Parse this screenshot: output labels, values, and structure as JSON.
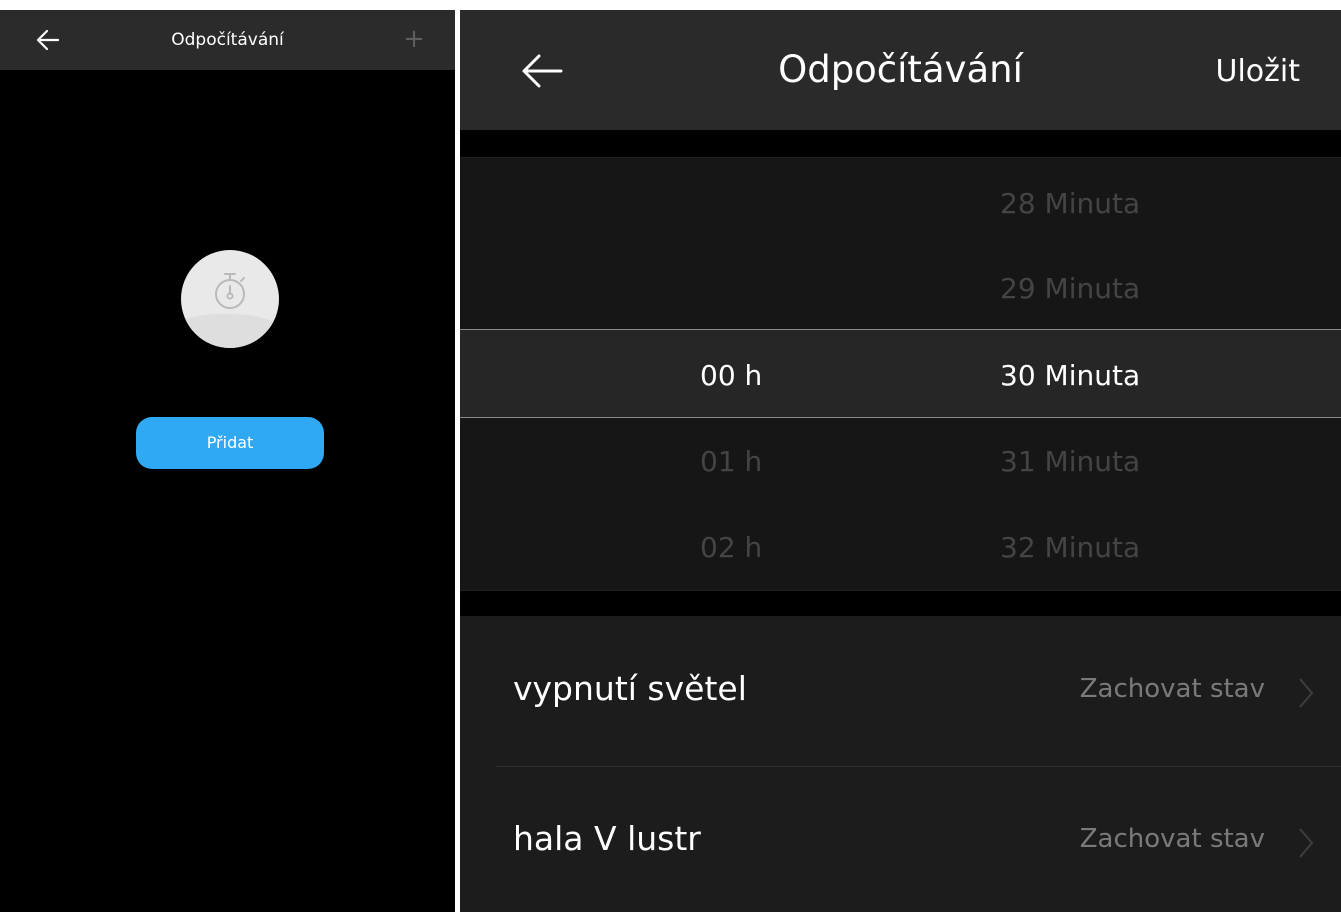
{
  "left_screen": {
    "header": {
      "title": "Odpočítávání",
      "back_icon": "arrow-left-icon",
      "plus_label": "+"
    },
    "empty_state": {
      "icon": "stopwatch-icon",
      "add_button_label": "Přidat",
      "add_button_color": "#2fa9f3"
    }
  },
  "right_screen": {
    "header": {
      "title": "Odpočítávání",
      "save_label": "Uložit",
      "back_icon": "arrow-left-icon"
    },
    "picker": {
      "hours": [
        {
          "label": "00 h",
          "state": "selected"
        },
        {
          "label": "01 h",
          "state": "dim"
        },
        {
          "label": "02 h",
          "state": "dim"
        }
      ],
      "minutes": [
        {
          "label": "28 Minuta",
          "state": "dim"
        },
        {
          "label": "29 Minuta",
          "state": "dim"
        },
        {
          "label": "30 Minuta",
          "state": "selected"
        },
        {
          "label": "31 Minuta",
          "state": "dim"
        },
        {
          "label": "32 Minuta",
          "state": "dim"
        }
      ]
    },
    "settings": [
      {
        "label": "vypnutí světel",
        "value": "Zachovat stav"
      },
      {
        "label": "hala V lustr",
        "value": "Zachovat stav"
      }
    ]
  }
}
